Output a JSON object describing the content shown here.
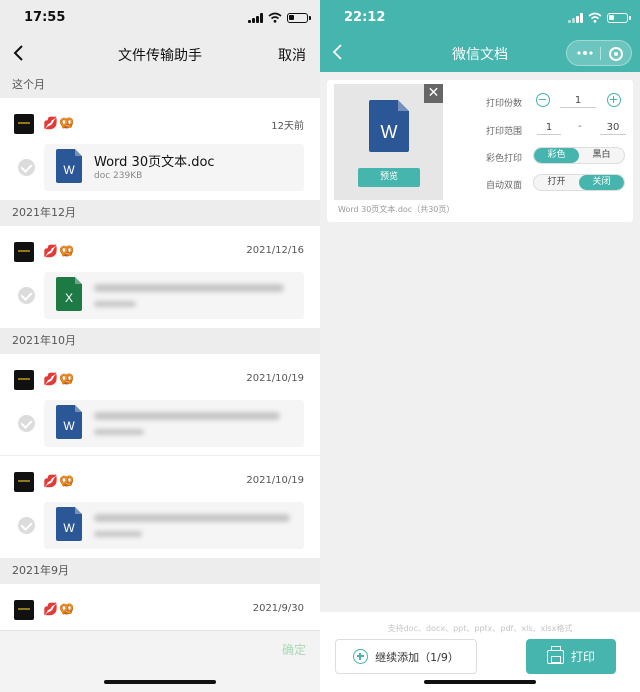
{
  "left": {
    "status": {
      "time": "17:55"
    },
    "nav": {
      "title": "文件传输助手",
      "cancel": "取消"
    },
    "sections": [
      {
        "label": "这个月",
        "rows": [
          {
            "emoji": "💋🥨",
            "date": "12天前",
            "file_type": "word",
            "icon_letter": "W",
            "file_name": "Word 30页文本.doc",
            "file_size": "doc 239KB",
            "blurred": false
          }
        ]
      },
      {
        "label": "2021年12月",
        "rows": [
          {
            "emoji": "💋🥨",
            "date": "2021/12/16",
            "file_type": "excel",
            "icon_letter": "X",
            "blurred": true
          }
        ]
      },
      {
        "label": "2021年10月",
        "rows": [
          {
            "emoji": "💋🥨",
            "date": "2021/10/19",
            "file_type": "word",
            "icon_letter": "W",
            "blurred": true
          },
          {
            "emoji": "💋🥨",
            "date": "2021/10/19",
            "file_type": "word",
            "icon_letter": "W",
            "blurred": true
          }
        ]
      },
      {
        "label": "2021年9月",
        "rows": [
          {
            "emoji": "💋🥨",
            "date": "2021/9/30",
            "blurred": true
          }
        ]
      }
    ],
    "footer": {
      "confirm": "确定"
    }
  },
  "right": {
    "status": {
      "time": "22:12"
    },
    "nav": {
      "title": "微信文档"
    },
    "doc": {
      "icon_letter": "W",
      "preview_label": "预览",
      "close_symbol": "✕",
      "caption": "Word 30页文本.doc（共30页）"
    },
    "options": {
      "copies_label": "打印份数",
      "copies_value": "1",
      "range_label": "打印范围",
      "range_from": "1",
      "range_sep": "-",
      "range_to": "30",
      "color_label": "彩色打印",
      "color_on": "彩色",
      "color_off": "黑白",
      "duplex_label": "自动双面",
      "duplex_on": "打开",
      "duplex_off": "关闭"
    },
    "footer": {
      "support_text": "支持doc、docx、ppt、pptx、pdf、xls、xlsx格式",
      "add_button": "继续添加（1/9）",
      "print_button": "打印"
    }
  },
  "colors": {
    "accent": "#45b5ad",
    "word_blue": "#2b5797",
    "excel_green": "#1d7a45"
  }
}
